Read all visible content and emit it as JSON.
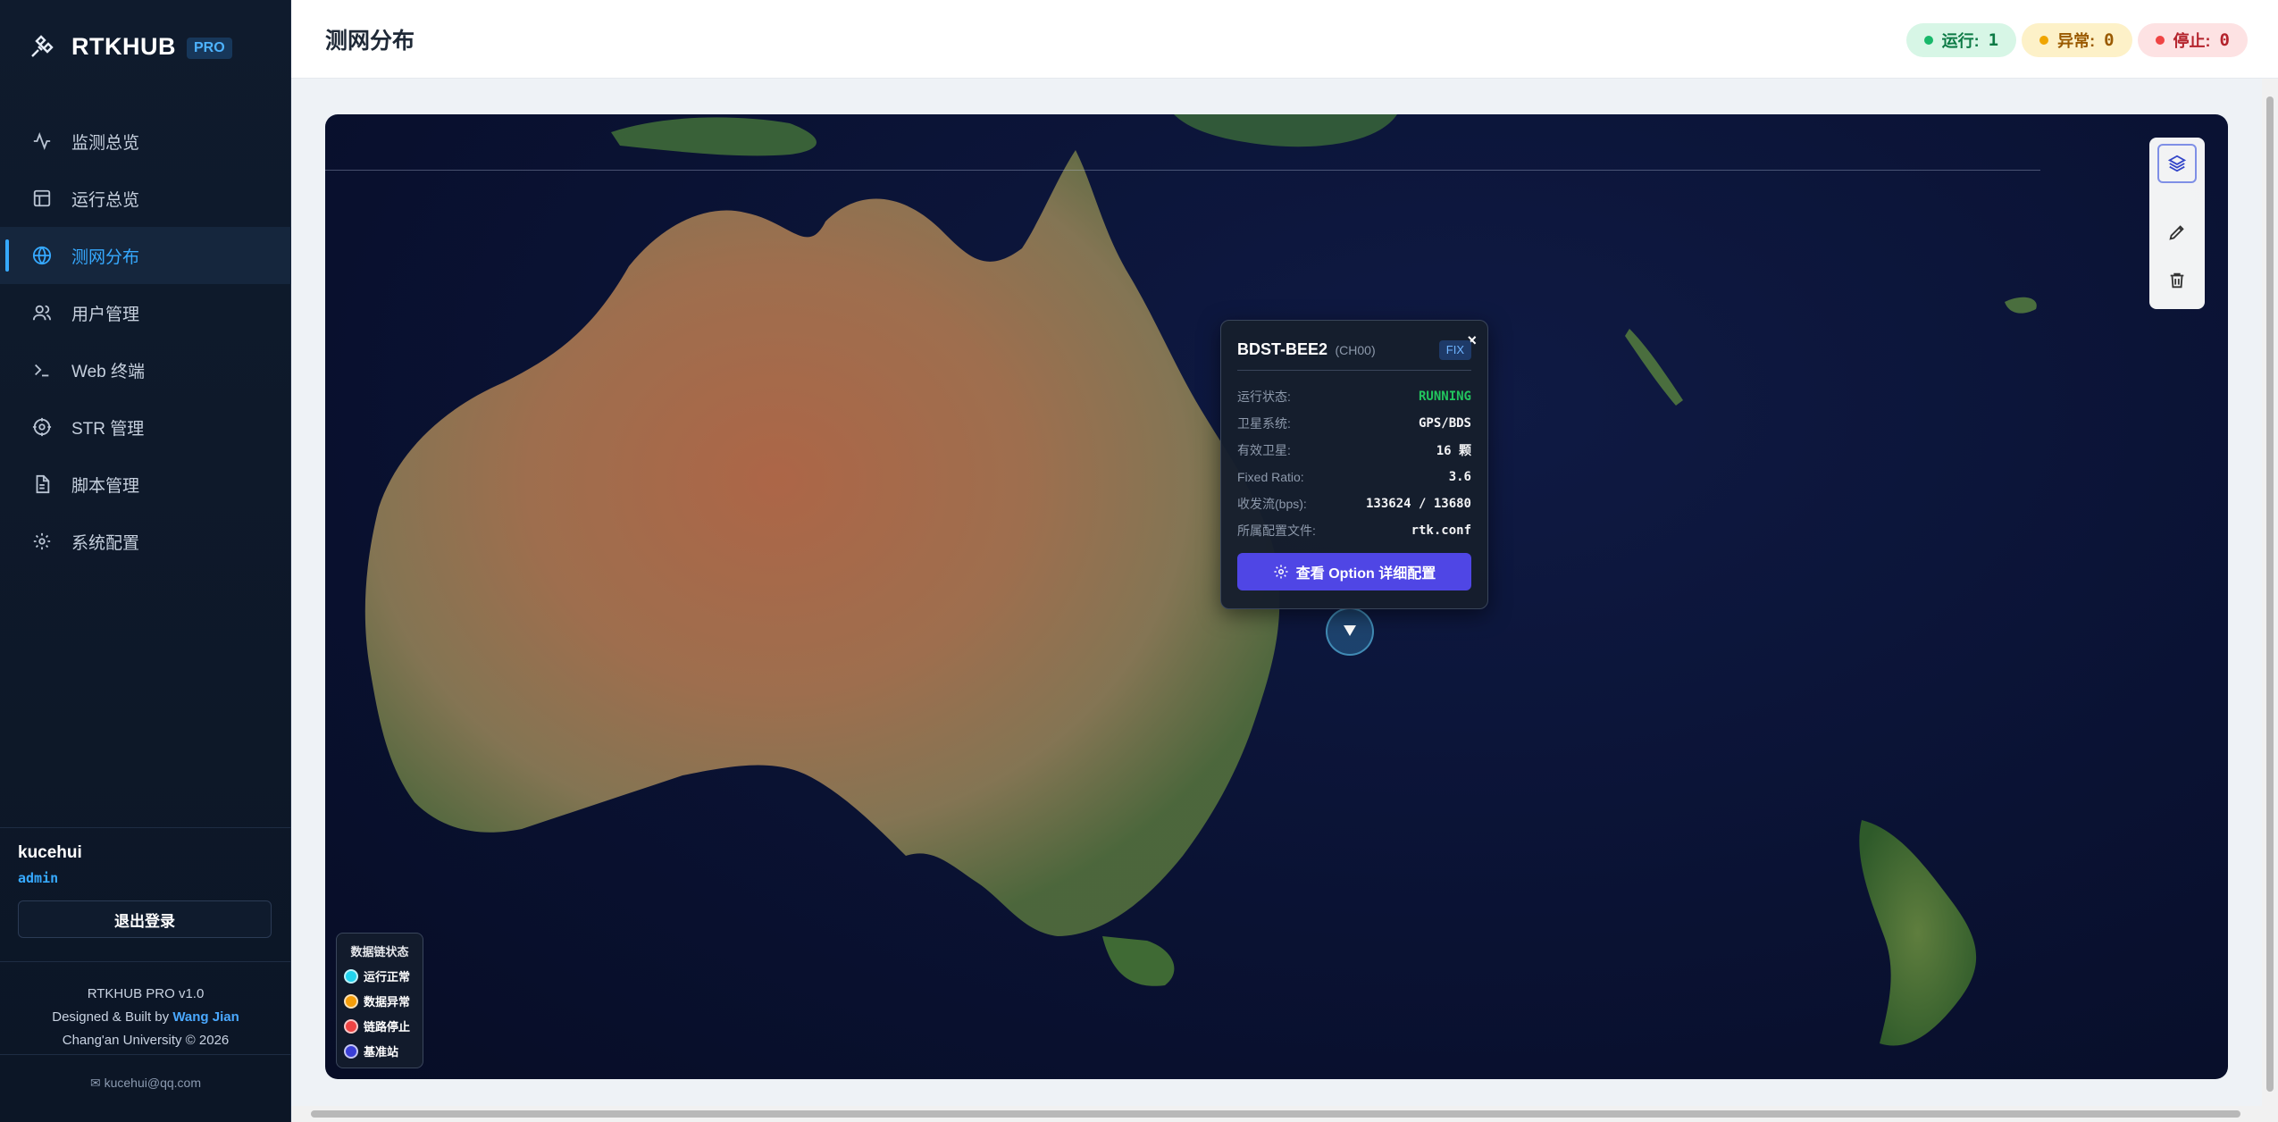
{
  "brand": {
    "title": "RTKHUB",
    "badge": "PRO"
  },
  "nav": [
    {
      "label": "监测总览",
      "icon": "activity-icon"
    },
    {
      "label": "运行总览",
      "icon": "layout-icon"
    },
    {
      "label": "测网分布",
      "icon": "globe-icon",
      "active": true
    },
    {
      "label": "用户管理",
      "icon": "users-icon"
    },
    {
      "label": "Web 终端",
      "icon": "terminal-icon"
    },
    {
      "label": "STR 管理",
      "icon": "target-icon"
    },
    {
      "label": "脚本管理",
      "icon": "file-icon"
    },
    {
      "label": "系统配置",
      "icon": "gear-icon"
    }
  ],
  "user": {
    "name": "kucehui",
    "role": "admin",
    "logout_label": "退出登录"
  },
  "footer": {
    "version": "RTKHUB PRO v1.0",
    "designed_prefix": "Designed & Built by",
    "author": "Wang Jian",
    "org": "Chang'an University © 2026",
    "email": "kucehui@qq.com"
  },
  "header": {
    "title": "测网分布",
    "pills": [
      {
        "label": "运行:",
        "count": "1",
        "kind": "run"
      },
      {
        "label": "异常:",
        "count": "0",
        "kind": "warn"
      },
      {
        "label": "停止:",
        "count": "0",
        "kind": "stop"
      }
    ]
  },
  "popup": {
    "station": "BDST-BEE2",
    "channel": "(CH00)",
    "tag": "FIX",
    "close": "×",
    "fields": [
      {
        "k": "运行状态:",
        "v": "RUNNING"
      },
      {
        "k": "卫星系统:",
        "v": "GPS/BDS"
      },
      {
        "k": "有效卫星:",
        "v": "16 颗"
      },
      {
        "k": "Fixed Ratio:",
        "v": "3.6"
      },
      {
        "k": "收发流(bps):",
        "v": "133624 / 13680"
      },
      {
        "k": "所属配置文件:",
        "v": "rtk.conf"
      }
    ],
    "button": "查看 Option 详细配置"
  },
  "legend": {
    "title": "数据链状态",
    "items": [
      {
        "label": "运行正常",
        "color": "#22d3ee"
      },
      {
        "label": "数据异常",
        "color": "#f59e0b"
      },
      {
        "label": "链路停止",
        "color": "#ef4444"
      },
      {
        "label": "基准站",
        "color": "#3b3fd6"
      }
    ]
  },
  "colors": {
    "accent": "#36a9ff",
    "primary_button": "#4f46e5",
    "running": "#22c55e"
  }
}
